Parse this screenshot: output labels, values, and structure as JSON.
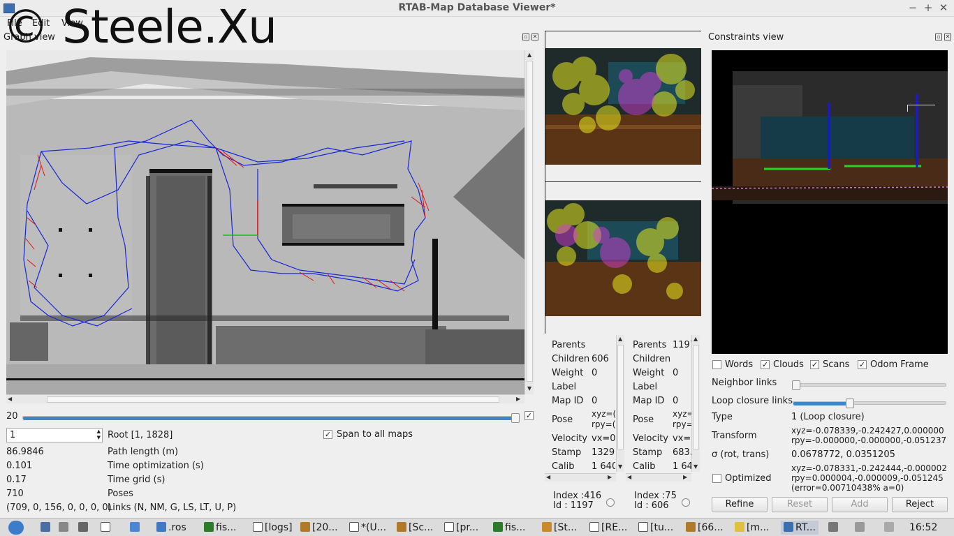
{
  "window": {
    "title": "RTAB-Map Database Viewer*",
    "minimize": "−",
    "maximize": "+",
    "close": "✕"
  },
  "watermark": "© Steele.Xu",
  "menu": [
    "File",
    "Edit",
    "View"
  ],
  "graph_view": {
    "title": "Graph view",
    "slider_value": "20",
    "spin_value": "1",
    "root": "Root [1, 1828]",
    "span_label": "Span to all maps",
    "stats": [
      {
        "value": "86.9846",
        "label": "Path length (m)"
      },
      {
        "value": "0.101",
        "label": "Time optimization (s)"
      },
      {
        "value": "0.17",
        "label": "Time grid (s)"
      },
      {
        "value": "710",
        "label": "Poses"
      },
      {
        "value": "(709, 0, 156, 0, 0, 0, 0)",
        "label": "Links (N, NM, G, LS, LT, U, P)"
      }
    ]
  },
  "node_left": {
    "rows": [
      {
        "label": "Parents",
        "value": ""
      },
      {
        "label": "Children",
        "value": "606"
      },
      {
        "label": "Weight",
        "value": "0"
      },
      {
        "label": "Label",
        "value": ""
      },
      {
        "label": "Map ID",
        "value": "0"
      },
      {
        "label": "Pose",
        "value": "xyz=(",
        "value2": "rpy=("
      },
      {
        "label": "Velocity",
        "value": "vx=0"
      },
      {
        "label": "Stamp",
        "value": "1329."
      },
      {
        "label": "Calib",
        "value": "1 640"
      }
    ],
    "index": "Index :416",
    "id": "Id :    1197"
  },
  "node_right": {
    "rows": [
      {
        "label": "Parents",
        "value": "1197"
      },
      {
        "label": "Children",
        "value": ""
      },
      {
        "label": "Weight",
        "value": "0"
      },
      {
        "label": "Label",
        "value": ""
      },
      {
        "label": "Map ID",
        "value": "0"
      },
      {
        "label": "Pose",
        "value": "xyz=",
        "value2": "rpy="
      },
      {
        "label": "Velocity",
        "value": "vx=("
      },
      {
        "label": "Stamp",
        "value": "683."
      },
      {
        "label": "Calib",
        "value": "1 64"
      }
    ],
    "index": "Index :75",
    "id": "Id :    606"
  },
  "constraints": {
    "title": "Constraints view",
    "checkboxes": [
      {
        "label": "Words",
        "checked": false
      },
      {
        "label": "Clouds",
        "checked": true
      },
      {
        "label": "Scans",
        "checked": true
      },
      {
        "label": "Odom Frame",
        "checked": true
      }
    ],
    "neighbor_links": "Neighbor links",
    "loop_closure_links": "Loop closure links",
    "type_label": "Type",
    "type_value": "1 (Loop closure)",
    "transform_label": "Transform",
    "transform_1": "xyz=-0.078339,-0.242427,0.000000",
    "transform_2": "rpy=-0.000000,-0.000000,-0.051237",
    "sigma_label": "σ (rot, trans)",
    "sigma_value": "0.0678772, 0.0351205",
    "optimized_label": "Optimized",
    "opt_1": "xyz=-0.078331,-0.242444,-0.000002",
    "opt_2": "rpy=0.000004,-0.000009,-0.051245",
    "opt_3": "(error=0.00710438% a=0)",
    "buttons": {
      "refine": "Refine",
      "reset": "Reset",
      "add": "Add",
      "reject": "Reject"
    }
  },
  "taskbar": {
    "items": [
      ".ros",
      "fis...",
      "[logs]",
      "[20...",
      "*(U...",
      "[Sc...",
      "[pr...",
      "fis...",
      "[St...",
      "[RE...",
      "[tu...",
      "[66...",
      "[m...",
      "RT..."
    ],
    "clock": "16:52"
  }
}
